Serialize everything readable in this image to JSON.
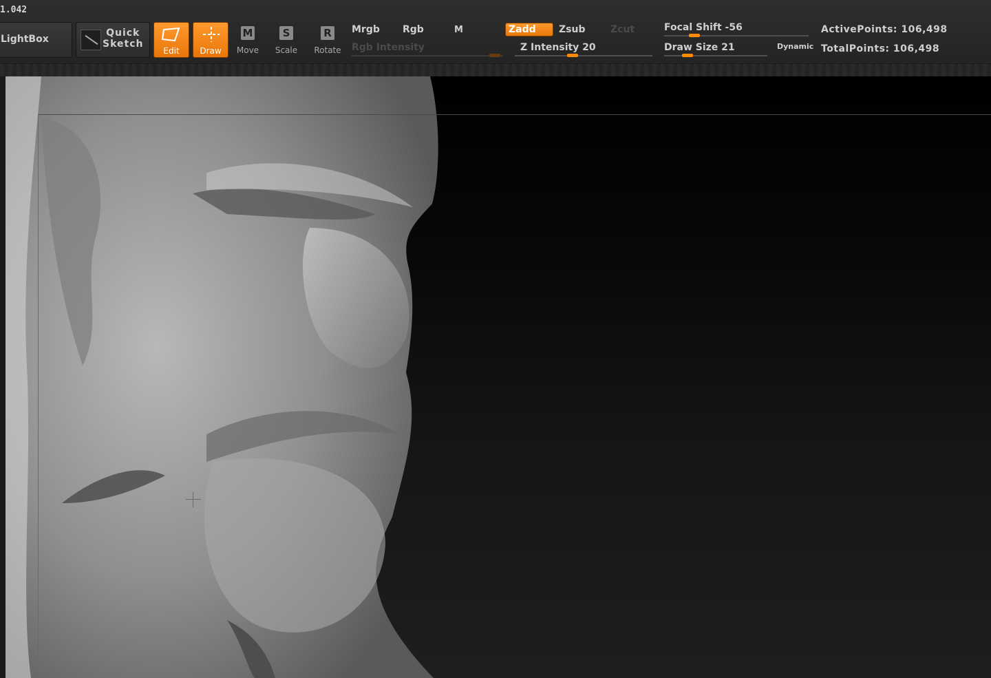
{
  "app": {
    "version": "1.042"
  },
  "toolbar": {
    "lightbox": "LightBox",
    "quick_sketch": [
      "Quick",
      "Sketch"
    ],
    "tools": [
      {
        "label": "Edit",
        "active": true
      },
      {
        "label": "Draw",
        "active": true
      },
      {
        "label": "Move",
        "active": false,
        "icon_letter": "M"
      },
      {
        "label": "Scale",
        "active": false,
        "icon_letter": "S"
      },
      {
        "label": "Rotate",
        "active": false,
        "icon_letter": "R"
      }
    ],
    "mrgb": "Mrgb",
    "rgb": "Rgb",
    "m": "M",
    "rgb_intensity": "Rgb Intensity",
    "zadd": "Zadd",
    "zsub": "Zsub",
    "zcut": "Zcut",
    "z_intensity": "Z Intensity 20",
    "focal_shift": "Focal Shift -56",
    "draw_size": "Draw Size 21",
    "dynamic": "Dynamic",
    "active_points": "ActivePoints: 106,498",
    "total_points": "TotalPoints: 106,498"
  },
  "colors": {
    "accent": "#ff8c00",
    "panel": "#2b2b2b",
    "canvas": "#000000"
  }
}
